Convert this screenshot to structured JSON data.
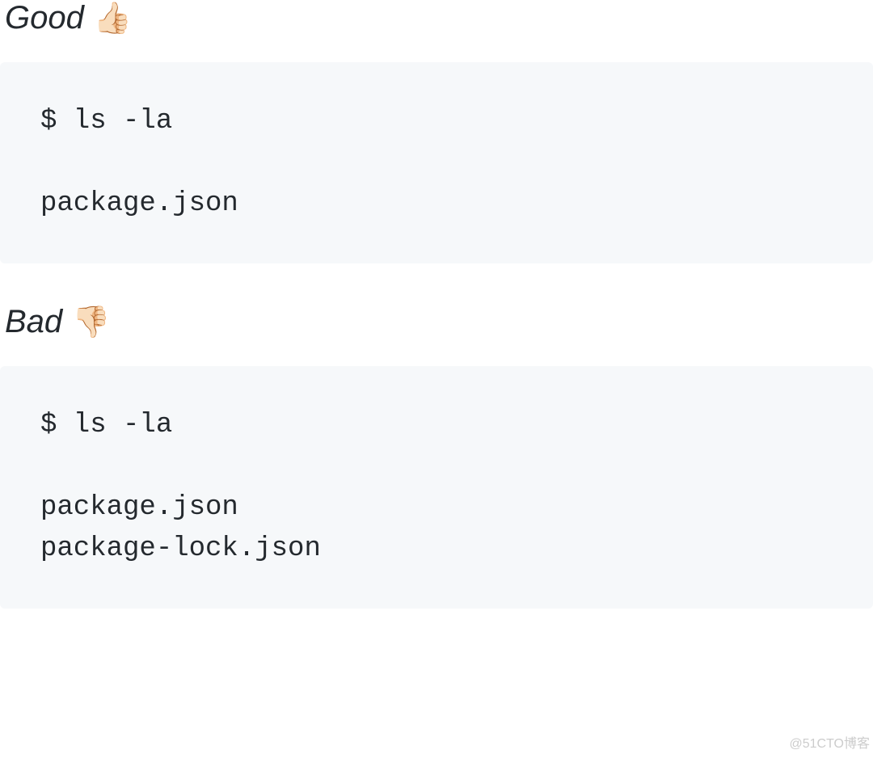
{
  "good": {
    "label": "Good",
    "emoji": "👍🏻",
    "code": "$ ls -la\n\npackage.json"
  },
  "bad": {
    "label": "Bad",
    "emoji": "👎🏻",
    "code": "$ ls -la\n\npackage.json\npackage-lock.json"
  },
  "watermark": "@51CTO博客"
}
